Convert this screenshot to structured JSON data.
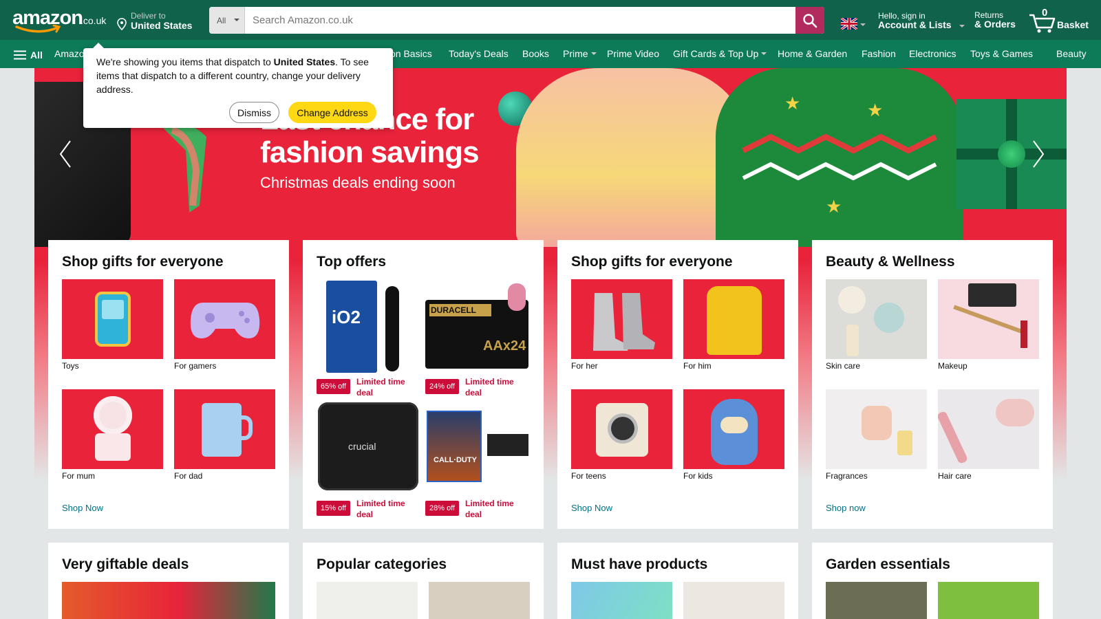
{
  "header": {
    "logo_text": "amazon",
    "logo_tld": ".co.uk",
    "deliver_label": "Deliver to",
    "deliver_country": "United States",
    "search_category": "All",
    "search_placeholder": "Search Amazon.co.uk",
    "account_line1": "Hello, sign in",
    "account_line2": "Account & Lists",
    "returns_line1": "Returns",
    "returns_line2": "& Orders",
    "basket_count": "0",
    "basket_label": "Basket"
  },
  "subnav": {
    "all_label": "All",
    "items": [
      {
        "label": "Amazon Basics"
      },
      {
        "label": "Today's Deals"
      },
      {
        "label": "Books"
      },
      {
        "label": "Prime"
      },
      {
        "label": "Prime Video"
      },
      {
        "label": "Gift Cards & Top Up"
      },
      {
        "label": "Home & Garden"
      },
      {
        "label": "Fashion"
      },
      {
        "label": "Electronics"
      },
      {
        "label": "Toys & Games"
      },
      {
        "label": "Beauty"
      }
    ],
    "first_item_visible": "Amazo",
    "second_item_visible": "on Basics"
  },
  "popover": {
    "text_before": "We're showing you items that dispatch to ",
    "country": "United States",
    "text_after": ". To see items that dispatch to a different country, change your delivery address.",
    "dismiss_label": "Dismiss",
    "change_label": "Change Address"
  },
  "hero": {
    "title_line1": "Last chance for",
    "title_line2": "fashion savings",
    "subtitle": "Christmas deals ending soon"
  },
  "cards": [
    {
      "title": "Shop gifts for everyone",
      "tiles": [
        {
          "caption": "Toys",
          "icon": "toy-icon"
        },
        {
          "caption": "For gamers",
          "icon": "gamepad-icon"
        },
        {
          "caption": "For mum",
          "icon": "perfume-icon"
        },
        {
          "caption": "For dad",
          "icon": "mug-icon"
        }
      ],
      "link": "Shop Now"
    },
    {
      "title": "Top offers",
      "offers": [
        {
          "badge": "65% off",
          "deal": "Limited time deal",
          "product": "Oral-B iO2"
        },
        {
          "badge": "24% off",
          "deal": "Limited time deal",
          "product": "Duracell Plus AAx24"
        },
        {
          "badge": "15% off",
          "deal": "Limited time deal",
          "product": "Crucial SSD"
        },
        {
          "badge": "28% off",
          "deal": "Limited time deal",
          "product": "Call of Duty Black Ops 6 PS5"
        }
      ]
    },
    {
      "title": "Shop gifts for everyone",
      "tiles": [
        {
          "caption": "For her",
          "icon": "boots-icon"
        },
        {
          "caption": "For him",
          "icon": "jacket-icon"
        },
        {
          "caption": "For teens",
          "icon": "camera-icon"
        },
        {
          "caption": "For kids",
          "icon": "plush-icon"
        }
      ],
      "link": "Shop Now"
    },
    {
      "title": "Beauty & Wellness",
      "tiles": [
        {
          "caption": "Skin care",
          "icon": "skincare-icon"
        },
        {
          "caption": "Makeup",
          "icon": "makeup-icon"
        },
        {
          "caption": "Fragrances",
          "icon": "fragrance-icon"
        },
        {
          "caption": "Hair care",
          "icon": "hairdryer-icon"
        }
      ],
      "link": "Shop now"
    }
  ],
  "bottom_cards": [
    {
      "title": "Very giftable deals"
    },
    {
      "title": "Popular categories"
    },
    {
      "title": "Must have products"
    },
    {
      "title": "Garden essentials"
    }
  ],
  "colors": {
    "nav_top": "#10624b",
    "nav_sub": "#0d7a58",
    "search_button": "#b12b5e",
    "hero_red": "#e8233a",
    "badge_red": "#cc0c39",
    "link": "#007185",
    "change_button": "#ffd814"
  }
}
